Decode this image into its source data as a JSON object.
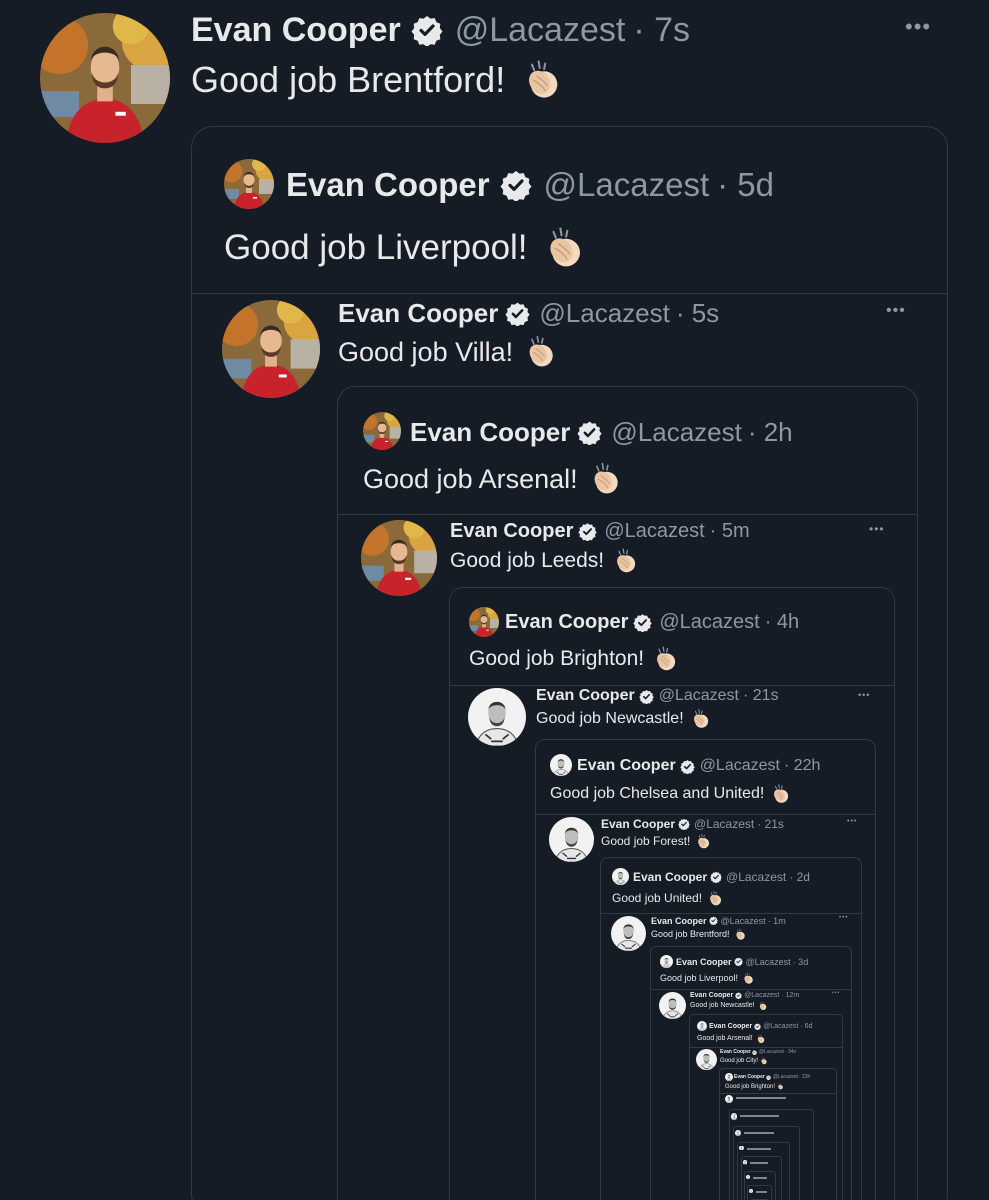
{
  "user": {
    "name": "Evan Cooper",
    "handle": "@Lacazest"
  },
  "tweets": [
    {
      "time": "· 7s",
      "text": "Good job Brentford!"
    },
    {
      "time": "· 5d",
      "text": "Good job Liverpool!"
    },
    {
      "time": "· 5s",
      "text": "Good job Villa!"
    },
    {
      "time": "· 2h",
      "text": "Good job Arsenal!"
    },
    {
      "time": "· 5m",
      "text": "Good job Leeds!"
    },
    {
      "time": "· 4h",
      "text": "Good job Brighton!"
    },
    {
      "time": "· 21s",
      "text": "Good job Newcastle!"
    },
    {
      "time": "· 22h",
      "text": "Good job Chelsea and United!"
    },
    {
      "time": "· 21s",
      "text": "Good job Forest!"
    },
    {
      "time": "· 2d",
      "text": "Good job United!"
    },
    {
      "time": "· 1m",
      "text": "Good job Brentford!"
    },
    {
      "time": "· 3d",
      "text": "Good job Liverpool!"
    },
    {
      "time": "· 12m",
      "text": "Good job Newcastle!"
    },
    {
      "time": "· 6d",
      "text": "Good job Arsenal!"
    },
    {
      "time": "· 34s",
      "text": "Good job City!"
    },
    {
      "time": "· 23h",
      "text": "Good job Brighton!"
    }
  ],
  "more_label": "•••",
  "colors": {
    "background": "#161c26",
    "border": "#2f3a45",
    "muted": "#8b98a5",
    "text": "#e7e9ea"
  },
  "icons": {
    "verified": "verified-badge-icon",
    "clap": "clapping-hands-emoji",
    "more": "more-options-icon"
  }
}
